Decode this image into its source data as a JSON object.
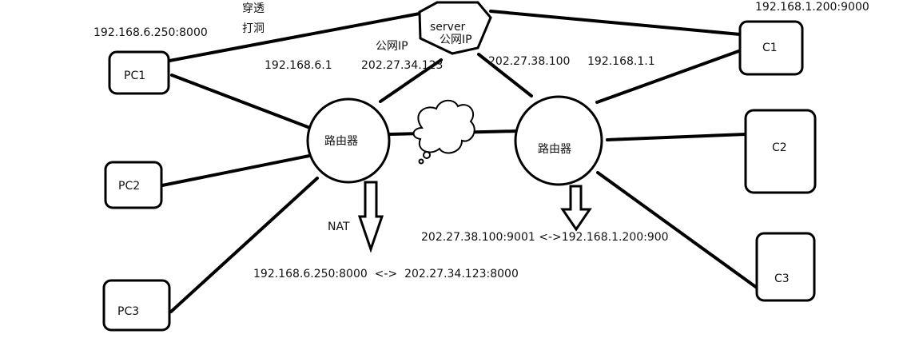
{
  "server": {
    "label": "server",
    "public_ip_label": "公网IP"
  },
  "pc1": {
    "label": "PC1",
    "addr": "192.168.6.250:8000"
  },
  "pc2": {
    "label": "PC2"
  },
  "pc3": {
    "label": "PC3"
  },
  "c1": {
    "label": "C1",
    "addr": "192.168.1.200:9000"
  },
  "c2": {
    "label": "C2"
  },
  "c3": {
    "label": "C3"
  },
  "punch": {
    "line1": "穿透",
    "line2": "打洞"
  },
  "router_left": {
    "label": "路由器",
    "lan_ip": "192.168.6.1",
    "wan_label": "公网IP",
    "wan_ip": "202.27.34.123"
  },
  "router_right": {
    "label": "路由器",
    "wan_ip": "202.27.38.100",
    "lan_ip": "192.168.1.1"
  },
  "nat": {
    "label": "NAT",
    "left_mapping": "192.168.6.250:8000  <->  202.27.34.123:8000",
    "right_mapping": "202.27.38.100:9001 <->192.168.1.200:900"
  }
}
